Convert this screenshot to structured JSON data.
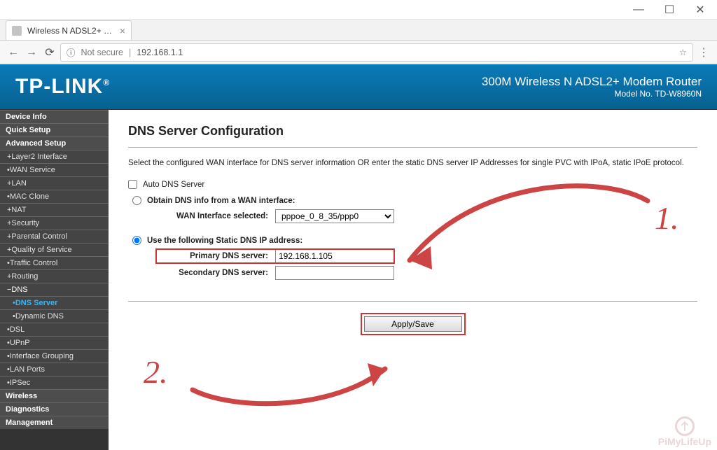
{
  "window": {
    "tab_title": "Wireless N ADSL2+ Mod…",
    "url": "192.168.1.1",
    "security_label": "Not secure"
  },
  "banner": {
    "brand": "TP-LINK",
    "product": "300M Wireless N ADSL2+ Modem Router",
    "model": "Model No. TD-W8960N"
  },
  "sidebar": {
    "items": [
      {
        "label": "Device Info",
        "type": "top"
      },
      {
        "label": "Quick Setup",
        "type": "top"
      },
      {
        "label": "Advanced Setup",
        "type": "top"
      },
      {
        "label": "+Layer2 Interface",
        "type": "sub"
      },
      {
        "label": "•WAN Service",
        "type": "sub"
      },
      {
        "label": "+LAN",
        "type": "sub"
      },
      {
        "label": "•MAC Clone",
        "type": "sub"
      },
      {
        "label": "+NAT",
        "type": "sub"
      },
      {
        "label": "+Security",
        "type": "sub"
      },
      {
        "label": "+Parental Control",
        "type": "sub"
      },
      {
        "label": "+Quality of Service",
        "type": "sub"
      },
      {
        "label": "•Traffic Control",
        "type": "sub"
      },
      {
        "label": "+Routing",
        "type": "sub"
      },
      {
        "label": "−DNS",
        "type": "sub",
        "expanded": true
      },
      {
        "label": "•DNS Server",
        "type": "sub",
        "selected": true,
        "indent": 2
      },
      {
        "label": "•Dynamic DNS",
        "type": "sub",
        "indent": 2
      },
      {
        "label": "•DSL",
        "type": "sub"
      },
      {
        "label": "•UPnP",
        "type": "sub"
      },
      {
        "label": "•Interface Grouping",
        "type": "sub"
      },
      {
        "label": "•LAN Ports",
        "type": "sub"
      },
      {
        "label": "•IPSec",
        "type": "sub"
      },
      {
        "label": "Wireless",
        "type": "top"
      },
      {
        "label": "Diagnostics",
        "type": "top"
      },
      {
        "label": "Management",
        "type": "top"
      }
    ]
  },
  "page": {
    "heading": "DNS Server Configuration",
    "description": "Select the configured WAN interface for DNS server information OR enter the static DNS server IP Addresses for single PVC with IPoA, static IPoE protocol.",
    "auto_dns_label": "Auto DNS Server",
    "auto_dns_checked": false,
    "mode_wan_label": "Obtain DNS info from a WAN interface:",
    "wan_iface_label": "WAN Interface selected:",
    "wan_iface_value": "pppoe_0_8_35/ppp0",
    "mode_static_label": "Use the following Static DNS IP address:",
    "static_selected": true,
    "primary_label": "Primary DNS server:",
    "primary_value": "192.168.1.105",
    "secondary_label": "Secondary DNS server:",
    "secondary_value": "",
    "apply_label": "Apply/Save"
  },
  "annotations": {
    "step1": "1.",
    "step2": "2."
  },
  "watermark": "PiMyLifeUp"
}
